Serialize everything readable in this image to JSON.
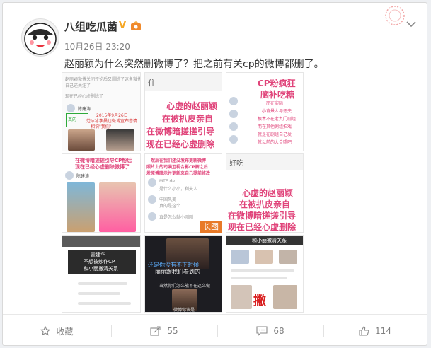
{
  "post": {
    "username": "八组吃瓜菌",
    "verified_badge": "V",
    "timestamp": "10月26日 23:20",
    "text": "赵丽颖为什么突然删微博了？把之前有关cp的微博都删了。"
  },
  "images": {
    "t1": {
      "line1": "赵丽颖微博关闭评论后又删除了这条微博",
      "line2": "自己还关注了",
      "line3": "现在已经心虚删除了",
      "user": "陈建涛",
      "date_stamp": "2015年9月26日",
      "caption": "范冰冰李晨也微博宣布恋情",
      "caption2": "相识\"我们\"",
      "box": "真的"
    },
    "t2": {
      "header": "住",
      "pink_lines": [
        "心虚的赵丽颖",
        "在被扒皮亲自",
        "在微博暗搓搓引导",
        "现在已经心虚删除"
      ]
    },
    "t3": {
      "pink_lines": [
        "CP粉疯狂",
        "脑补吃糖"
      ],
      "small_lines": [
        "而在实际",
        "小背景人与恶夫",
        "根本不在老九门剧组",
        "而在其他剧组拍戏",
        "就是在剧组自己发",
        "就以前的大合照吧"
      ]
    },
    "t4": {
      "pink_lines": [
        "在微博暗搓搓引导CP粉后",
        "现在已经心虚删除微博了"
      ],
      "user": "陈建涛"
    },
    "t5": {
      "pink_lines": [
        "然后在我们还没发布更新微博",
        "照片上的司满卫视合影CP解之后",
        "发原博暗示并更新来自己提前修改"
      ],
      "comments": [
        "MTE.de",
        "是什么小小，利夫人",
        "中国风美",
        "真的是这个",
        "真是怎么就小刚刚"
      ]
    },
    "t6": {
      "header": "好吃",
      "pink_lines": [
        "心虚的赵丽颖",
        "在被扒皮亲自",
        "在微博暗搓搓引导",
        "现在已经心虚删除"
      ],
      "long_label": "长图"
    },
    "t7": {
      "banner_lines": [
        "霍建华",
        "不想被炒作CP",
        "和小丽撇清关系"
      ]
    },
    "t8": {
      "overlay": "还是你没有不下时候",
      "overlay2": "丽丽跟我们看到的",
      "caption": "当然你们怎么能不在这么做",
      "caption2": "微博你该是"
    },
    "t9": {
      "banner": "和小丽撇清关系",
      "red_char": "撇"
    }
  },
  "footer": {
    "favorite_label": "收藏",
    "repost_count": "55",
    "comment_count": "68",
    "like_count": "114"
  },
  "colors": {
    "accent": "#e0447a",
    "gray_text": "#808080",
    "orange": "#f5a623"
  }
}
